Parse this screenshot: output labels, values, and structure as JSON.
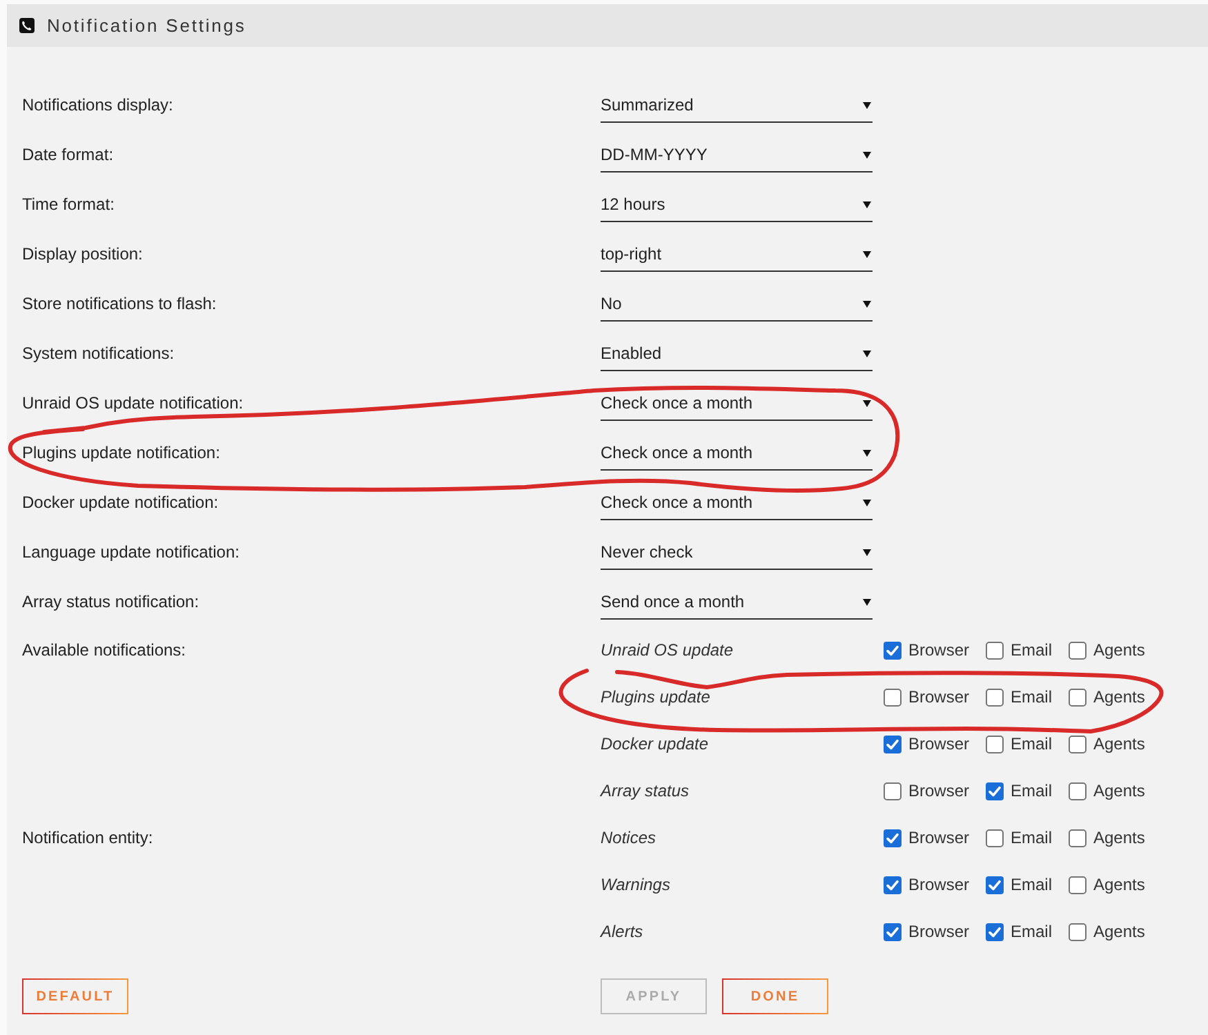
{
  "window": {
    "title": "Notification Settings"
  },
  "settings": [
    {
      "label": "Notifications display:",
      "value": "Summarized",
      "circled": false
    },
    {
      "label": "Date format:",
      "value": "DD-MM-YYYY",
      "circled": false
    },
    {
      "label": "Time format:",
      "value": "12 hours",
      "circled": false
    },
    {
      "label": "Display position:",
      "value": "top-right",
      "circled": false
    },
    {
      "label": "Store notifications to flash:",
      "value": "No",
      "circled": false
    },
    {
      "label": "System notifications:",
      "value": "Enabled",
      "circled": false
    },
    {
      "label": "Unraid OS update notification:",
      "value": "Check once a month",
      "circled": false
    },
    {
      "label": "Plugins update notification:",
      "value": "Check once a month",
      "circled": true
    },
    {
      "label": "Docker update notification:",
      "value": "Check once a month",
      "circled": false
    },
    {
      "label": "Language update notification:",
      "value": "Never check",
      "circled": false
    },
    {
      "label": "Array status notification:",
      "value": "Send once a month",
      "circled": false
    }
  ],
  "notification_groups": [
    {
      "label": "Available notifications:",
      "items": [
        {
          "name": "Unraid OS update",
          "circled": false,
          "options": [
            {
              "label": "Browser",
              "checked": true
            },
            {
              "label": "Email",
              "checked": false
            },
            {
              "label": "Agents",
              "checked": false
            }
          ]
        },
        {
          "name": "Plugins update",
          "circled": true,
          "options": [
            {
              "label": "Browser",
              "checked": false
            },
            {
              "label": "Email",
              "checked": false
            },
            {
              "label": "Agents",
              "checked": false
            }
          ]
        },
        {
          "name": "Docker update",
          "circled": false,
          "options": [
            {
              "label": "Browser",
              "checked": true
            },
            {
              "label": "Email",
              "checked": false
            },
            {
              "label": "Agents",
              "checked": false
            }
          ]
        },
        {
          "name": "Array status",
          "circled": false,
          "options": [
            {
              "label": "Browser",
              "checked": false
            },
            {
              "label": "Email",
              "checked": true
            },
            {
              "label": "Agents",
              "checked": false
            }
          ]
        }
      ]
    },
    {
      "label": "Notification entity:",
      "items": [
        {
          "name": "Notices",
          "circled": false,
          "options": [
            {
              "label": "Browser",
              "checked": true
            },
            {
              "label": "Email",
              "checked": false
            },
            {
              "label": "Agents",
              "checked": false
            }
          ]
        },
        {
          "name": "Warnings",
          "circled": false,
          "options": [
            {
              "label": "Browser",
              "checked": true
            },
            {
              "label": "Email",
              "checked": true
            },
            {
              "label": "Agents",
              "checked": false
            }
          ]
        },
        {
          "name": "Alerts",
          "circled": false,
          "options": [
            {
              "label": "Browser",
              "checked": true
            },
            {
              "label": "Email",
              "checked": true
            },
            {
              "label": "Agents",
              "checked": false
            }
          ]
        }
      ]
    }
  ],
  "footer": {
    "left": [
      {
        "label": "DEFAULT",
        "disabled": false
      }
    ],
    "right": [
      {
        "label": "APPLY",
        "disabled": true
      },
      {
        "label": "DONE",
        "disabled": false
      }
    ]
  }
}
